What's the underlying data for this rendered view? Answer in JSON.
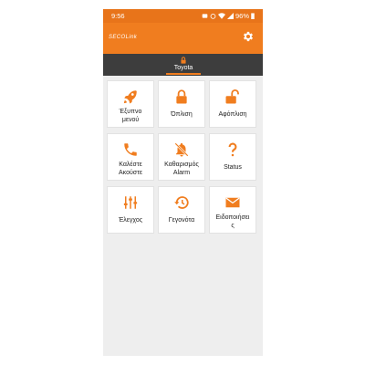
{
  "status_bar": {
    "time": "9:56",
    "battery": "96%"
  },
  "app_bar": {
    "logo": "SECOLink",
    "settings_icon": "gear-icon"
  },
  "tab": {
    "label": "Toyota",
    "icon": "lock-icon"
  },
  "colors": {
    "accent": "#f07d1f",
    "tab_bar": "#3d3d3d",
    "background": "#eeeeee",
    "tile": "#ffffff"
  },
  "tiles": [
    {
      "label": "Έξυπνο\nμενού",
      "icon": "rocket-icon"
    },
    {
      "label": "Όπλιση",
      "icon": "lock-icon"
    },
    {
      "label": "Αφόπλιση",
      "icon": "unlock-icon"
    },
    {
      "label": "Καλέστε\nΑκούστε",
      "icon": "phone-icon"
    },
    {
      "label": "Καθαρισμός\nAlarm",
      "icon": "bell-off-icon"
    },
    {
      "label": "Status",
      "icon": "question-icon"
    },
    {
      "label": "Έλεγχος",
      "icon": "sliders-icon"
    },
    {
      "label": "Γεγονότα",
      "icon": "history-icon"
    },
    {
      "label": "Ειδοποιήσει\nς",
      "icon": "envelope-icon"
    }
  ]
}
